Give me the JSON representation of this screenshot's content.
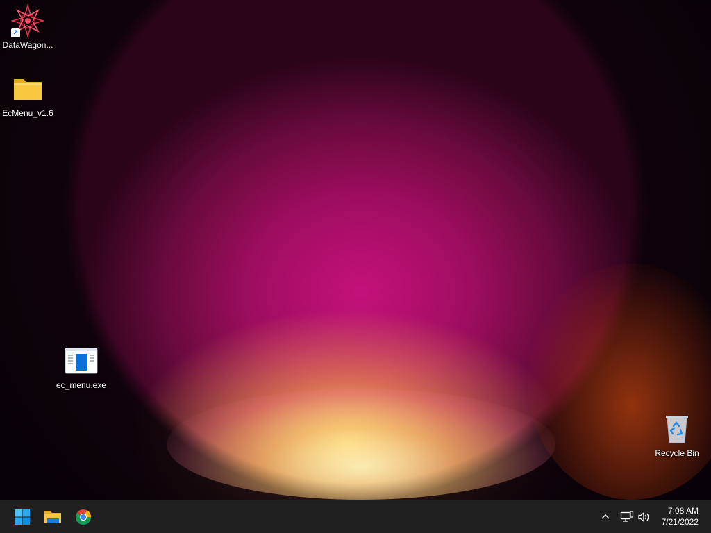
{
  "desktop": {
    "icons": [
      {
        "label": "DataWagon...",
        "icon": "datawagon-app-icon",
        "shortcut": true
      },
      {
        "label": "EcMenu_v1.6",
        "icon": "folder-icon"
      },
      {
        "label": "ec_menu.exe",
        "icon": "exe-window-icon"
      },
      {
        "label": "Recycle Bin",
        "icon": "recycle-bin-icon"
      }
    ]
  },
  "taskbar": {
    "pinned": [
      {
        "name": "Start",
        "icon": "windows-start-icon"
      },
      {
        "name": "File Explorer",
        "icon": "file-explorer-icon"
      },
      {
        "name": "Google Chrome",
        "icon": "chrome-icon"
      }
    ],
    "tray": {
      "overflow_icon": "chevron-up-icon",
      "network_icon": "network-icon",
      "volume_icon": "volume-icon"
    },
    "clock": {
      "time": "7:08 AM",
      "date": "7/21/2022"
    }
  },
  "colors": {
    "taskbar_bg": "#202020",
    "accent_blue": "#0078d4",
    "folder_yellow": "#f8c940"
  }
}
